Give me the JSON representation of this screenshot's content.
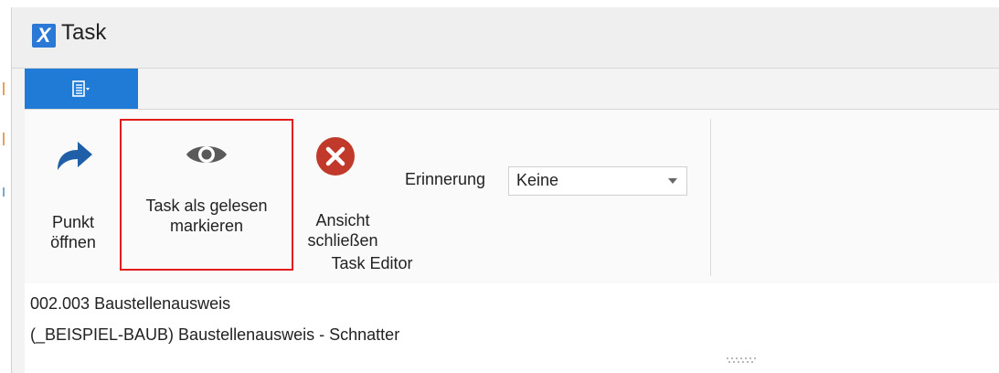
{
  "window": {
    "title": "Task",
    "app_icon_letter": "X"
  },
  "ribbon": {
    "buttons": [
      {
        "label_line1": "Punkt",
        "label_line2": "öffnen",
        "icon": "arrow-forward-icon"
      },
      {
        "label_line1": "Task als gelesen",
        "label_line2": "markieren",
        "icon": "eye-icon"
      },
      {
        "label_line1": "Ansicht",
        "label_line2": "schließen",
        "icon": "close-circle-icon"
      }
    ],
    "reminder": {
      "label": "Erinnerung",
      "value": "Keine"
    },
    "group_label": "Task Editor"
  },
  "content": {
    "line1": "002.003 Baustellenausweis",
    "line2": "(_BEISPIEL-BAUB) Baustellenausweis - Schnatter"
  },
  "colors": {
    "accent": "#1f7bd6",
    "highlight": "#e21b1b",
    "close_icon": "#c0392b",
    "arrow_icon": "#1f5fa8"
  }
}
